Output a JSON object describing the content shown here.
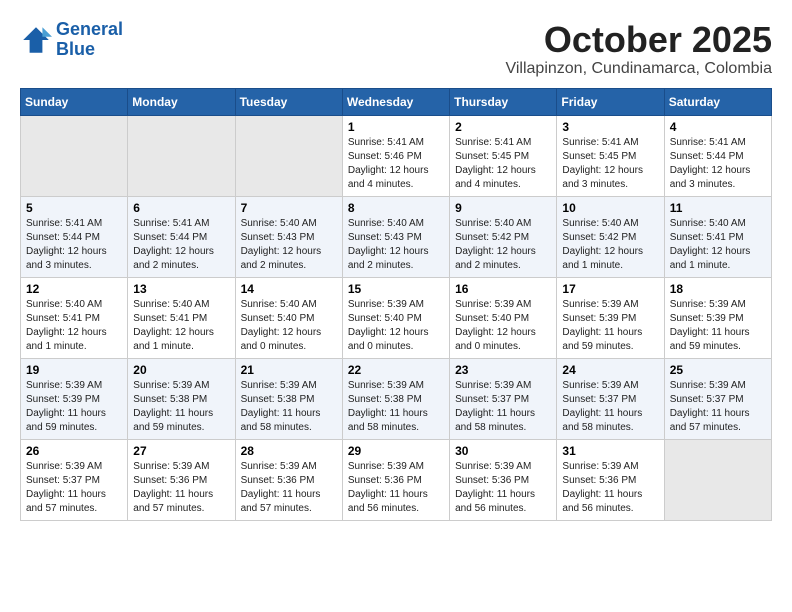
{
  "header": {
    "logo_line1": "General",
    "logo_line2": "Blue",
    "title": "October 2025",
    "subtitle": "Villapinzon, Cundinamarca, Colombia"
  },
  "days_of_week": [
    "Sunday",
    "Monday",
    "Tuesday",
    "Wednesday",
    "Thursday",
    "Friday",
    "Saturday"
  ],
  "weeks": [
    [
      {
        "day": "",
        "detail": ""
      },
      {
        "day": "",
        "detail": ""
      },
      {
        "day": "",
        "detail": ""
      },
      {
        "day": "1",
        "detail": "Sunrise: 5:41 AM\nSunset: 5:46 PM\nDaylight: 12 hours\nand 4 minutes."
      },
      {
        "day": "2",
        "detail": "Sunrise: 5:41 AM\nSunset: 5:45 PM\nDaylight: 12 hours\nand 4 minutes."
      },
      {
        "day": "3",
        "detail": "Sunrise: 5:41 AM\nSunset: 5:45 PM\nDaylight: 12 hours\nand 3 minutes."
      },
      {
        "day": "4",
        "detail": "Sunrise: 5:41 AM\nSunset: 5:44 PM\nDaylight: 12 hours\nand 3 minutes."
      }
    ],
    [
      {
        "day": "5",
        "detail": "Sunrise: 5:41 AM\nSunset: 5:44 PM\nDaylight: 12 hours\nand 3 minutes."
      },
      {
        "day": "6",
        "detail": "Sunrise: 5:41 AM\nSunset: 5:44 PM\nDaylight: 12 hours\nand 2 minutes."
      },
      {
        "day": "7",
        "detail": "Sunrise: 5:40 AM\nSunset: 5:43 PM\nDaylight: 12 hours\nand 2 minutes."
      },
      {
        "day": "8",
        "detail": "Sunrise: 5:40 AM\nSunset: 5:43 PM\nDaylight: 12 hours\nand 2 minutes."
      },
      {
        "day": "9",
        "detail": "Sunrise: 5:40 AM\nSunset: 5:42 PM\nDaylight: 12 hours\nand 2 minutes."
      },
      {
        "day": "10",
        "detail": "Sunrise: 5:40 AM\nSunset: 5:42 PM\nDaylight: 12 hours\nand 1 minute."
      },
      {
        "day": "11",
        "detail": "Sunrise: 5:40 AM\nSunset: 5:41 PM\nDaylight: 12 hours\nand 1 minute."
      }
    ],
    [
      {
        "day": "12",
        "detail": "Sunrise: 5:40 AM\nSunset: 5:41 PM\nDaylight: 12 hours\nand 1 minute."
      },
      {
        "day": "13",
        "detail": "Sunrise: 5:40 AM\nSunset: 5:41 PM\nDaylight: 12 hours\nand 1 minute."
      },
      {
        "day": "14",
        "detail": "Sunrise: 5:40 AM\nSunset: 5:40 PM\nDaylight: 12 hours\nand 0 minutes."
      },
      {
        "day": "15",
        "detail": "Sunrise: 5:39 AM\nSunset: 5:40 PM\nDaylight: 12 hours\nand 0 minutes."
      },
      {
        "day": "16",
        "detail": "Sunrise: 5:39 AM\nSunset: 5:40 PM\nDaylight: 12 hours\nand 0 minutes."
      },
      {
        "day": "17",
        "detail": "Sunrise: 5:39 AM\nSunset: 5:39 PM\nDaylight: 11 hours\nand 59 minutes."
      },
      {
        "day": "18",
        "detail": "Sunrise: 5:39 AM\nSunset: 5:39 PM\nDaylight: 11 hours\nand 59 minutes."
      }
    ],
    [
      {
        "day": "19",
        "detail": "Sunrise: 5:39 AM\nSunset: 5:39 PM\nDaylight: 11 hours\nand 59 minutes."
      },
      {
        "day": "20",
        "detail": "Sunrise: 5:39 AM\nSunset: 5:38 PM\nDaylight: 11 hours\nand 59 minutes."
      },
      {
        "day": "21",
        "detail": "Sunrise: 5:39 AM\nSunset: 5:38 PM\nDaylight: 11 hours\nand 58 minutes."
      },
      {
        "day": "22",
        "detail": "Sunrise: 5:39 AM\nSunset: 5:38 PM\nDaylight: 11 hours\nand 58 minutes."
      },
      {
        "day": "23",
        "detail": "Sunrise: 5:39 AM\nSunset: 5:37 PM\nDaylight: 11 hours\nand 58 minutes."
      },
      {
        "day": "24",
        "detail": "Sunrise: 5:39 AM\nSunset: 5:37 PM\nDaylight: 11 hours\nand 58 minutes."
      },
      {
        "day": "25",
        "detail": "Sunrise: 5:39 AM\nSunset: 5:37 PM\nDaylight: 11 hours\nand 57 minutes."
      }
    ],
    [
      {
        "day": "26",
        "detail": "Sunrise: 5:39 AM\nSunset: 5:37 PM\nDaylight: 11 hours\nand 57 minutes."
      },
      {
        "day": "27",
        "detail": "Sunrise: 5:39 AM\nSunset: 5:36 PM\nDaylight: 11 hours\nand 57 minutes."
      },
      {
        "day": "28",
        "detail": "Sunrise: 5:39 AM\nSunset: 5:36 PM\nDaylight: 11 hours\nand 57 minutes."
      },
      {
        "day": "29",
        "detail": "Sunrise: 5:39 AM\nSunset: 5:36 PM\nDaylight: 11 hours\nand 56 minutes."
      },
      {
        "day": "30",
        "detail": "Sunrise: 5:39 AM\nSunset: 5:36 PM\nDaylight: 11 hours\nand 56 minutes."
      },
      {
        "day": "31",
        "detail": "Sunrise: 5:39 AM\nSunset: 5:36 PM\nDaylight: 11 hours\nand 56 minutes."
      },
      {
        "day": "",
        "detail": ""
      }
    ]
  ]
}
